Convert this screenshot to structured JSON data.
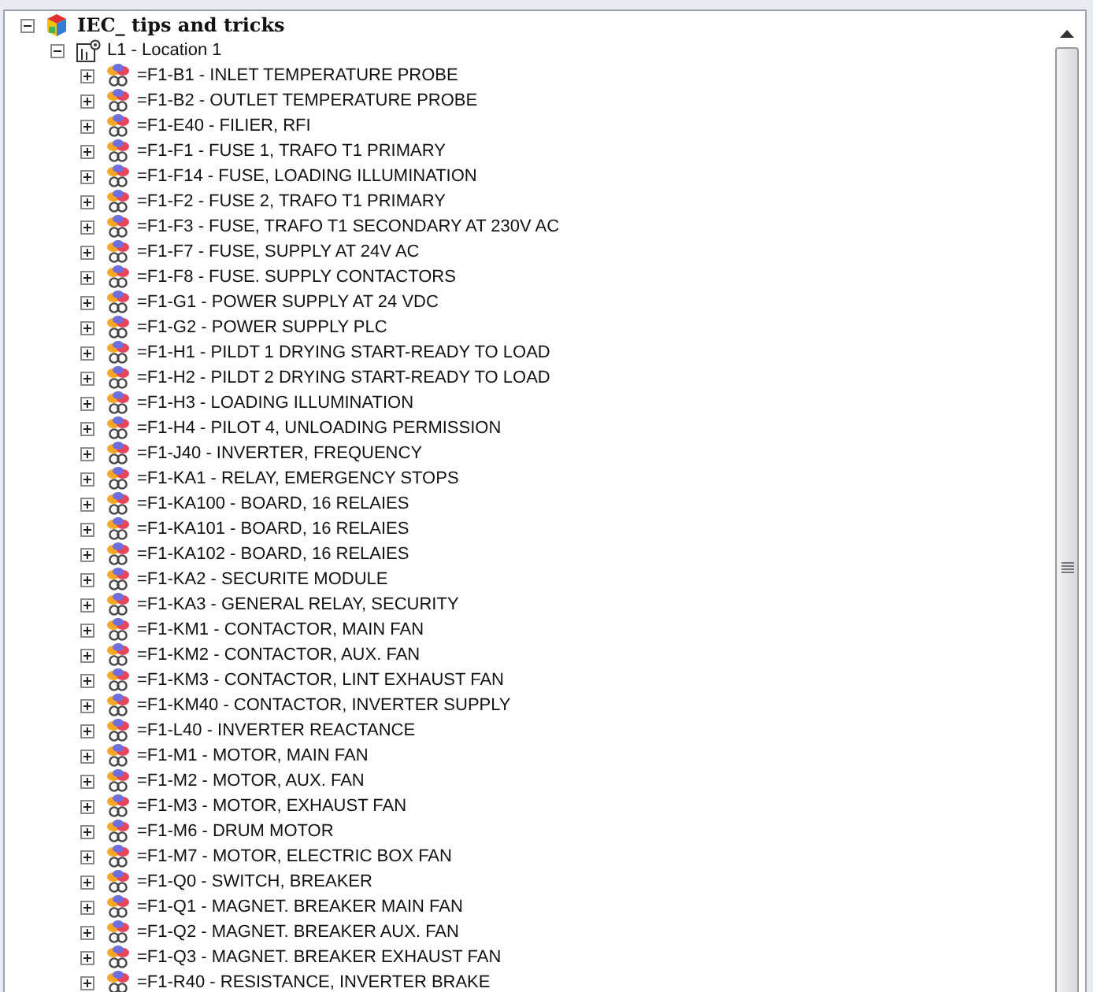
{
  "tree": {
    "label": "IEC_ tips and tricks",
    "kind": "project",
    "expanded": true,
    "children": [
      {
        "label": "L1 - Location 1",
        "kind": "location",
        "expanded": true,
        "children": [
          {
            "label": "=F1-B1 - INLET TEMPERATURE PROBE",
            "kind": "device",
            "expanded": false
          },
          {
            "label": "=F1-B2 - OUTLET TEMPERATURE PROBE",
            "kind": "device",
            "expanded": false
          },
          {
            "label": "=F1-E40 - FILIER, RFI",
            "kind": "device",
            "expanded": false
          },
          {
            "label": "=F1-F1 - FUSE 1, TRAFO T1 PRIMARY",
            "kind": "device",
            "expanded": false
          },
          {
            "label": "=F1-F14 - FUSE, LOADING ILLUMINATION",
            "kind": "device",
            "expanded": false
          },
          {
            "label": "=F1-F2 - FUSE 2, TRAFO T1 PRIMARY",
            "kind": "device",
            "expanded": false
          },
          {
            "label": "=F1-F3 - FUSE, TRAFO T1 SECONDARY AT 230V AC",
            "kind": "device",
            "expanded": false
          },
          {
            "label": "=F1-F7 - FUSE, SUPPLY AT 24V AC",
            "kind": "device",
            "expanded": false
          },
          {
            "label": "=F1-F8 - FUSE. SUPPLY CONTACTORS",
            "kind": "device",
            "expanded": false
          },
          {
            "label": "=F1-G1 - POWER SUPPLY AT 24 VDC",
            "kind": "device",
            "expanded": false
          },
          {
            "label": "=F1-G2 - POWER SUPPLY PLC",
            "kind": "device",
            "expanded": false
          },
          {
            "label": "=F1-H1 - PILDT 1 DRYING START-READY TO LOAD",
            "kind": "device",
            "expanded": false
          },
          {
            "label": "=F1-H2 - PILDT 2 DRYING START-READY TO LOAD",
            "kind": "device",
            "expanded": false
          },
          {
            "label": "=F1-H3 - LOADING ILLUMINATION",
            "kind": "device",
            "expanded": false
          },
          {
            "label": "=F1-H4 - PILOT 4, UNLOADING PERMISSION",
            "kind": "device",
            "expanded": false
          },
          {
            "label": "=F1-J40 - INVERTER, FREQUENCY",
            "kind": "device",
            "expanded": false
          },
          {
            "label": "=F1-KA1 - RELAY, EMERGENCY STOPS",
            "kind": "device",
            "expanded": false
          },
          {
            "label": "=F1-KA100 - BOARD, 16 RELAIES",
            "kind": "device",
            "expanded": false
          },
          {
            "label": "=F1-KA101 - BOARD, 16 RELAIES",
            "kind": "device",
            "expanded": false
          },
          {
            "label": "=F1-KA102 - BOARD, 16 RELAIES",
            "kind": "device",
            "expanded": false
          },
          {
            "label": "=F1-KA2 - SECURITE MODULE",
            "kind": "device",
            "expanded": false
          },
          {
            "label": "=F1-KA3 - GENERAL RELAY, SECURITY",
            "kind": "device",
            "expanded": false
          },
          {
            "label": "=F1-KM1 - CONTACTOR, MAIN FAN",
            "kind": "device",
            "expanded": false
          },
          {
            "label": "=F1-KM2 - CONTACTOR, AUX. FAN",
            "kind": "device",
            "expanded": false
          },
          {
            "label": "=F1-KM3 - CONTACTOR, LINT EXHAUST FAN",
            "kind": "device",
            "expanded": false
          },
          {
            "label": "=F1-KM40 - CONTACTOR, INVERTER SUPPLY",
            "kind": "device",
            "expanded": false
          },
          {
            "label": "=F1-L40 - INVERTER REACTANCE",
            "kind": "device",
            "expanded": false
          },
          {
            "label": "=F1-M1 - MOTOR, MAIN FAN",
            "kind": "device",
            "expanded": false
          },
          {
            "label": "=F1-M2 - MOTOR, AUX. FAN",
            "kind": "device",
            "expanded": false
          },
          {
            "label": "=F1-M3 - MOTOR, EXHAUST FAN",
            "kind": "device",
            "expanded": false
          },
          {
            "label": "=F1-M6 - DRUM MOTOR",
            "kind": "device",
            "expanded": false
          },
          {
            "label": "=F1-M7 - MOTOR, ELECTRIC BOX FAN",
            "kind": "device",
            "expanded": false
          },
          {
            "label": "=F1-Q0 - SWITCH, BREAKER",
            "kind": "device",
            "expanded": false
          },
          {
            "label": "=F1-Q1 - MAGNET. BREAKER MAIN FAN",
            "kind": "device",
            "expanded": false
          },
          {
            "label": "=F1-Q2 - MAGNET. BREAKER AUX. FAN",
            "kind": "device",
            "expanded": false
          },
          {
            "label": "=F1-Q3 - MAGNET. BREAKER EXHAUST FAN",
            "kind": "device",
            "expanded": false
          },
          {
            "label": "=F1-R40 - RESISTANCE, INVERTER BRAKE",
            "kind": "device",
            "expanded": false
          }
        ]
      }
    ]
  }
}
